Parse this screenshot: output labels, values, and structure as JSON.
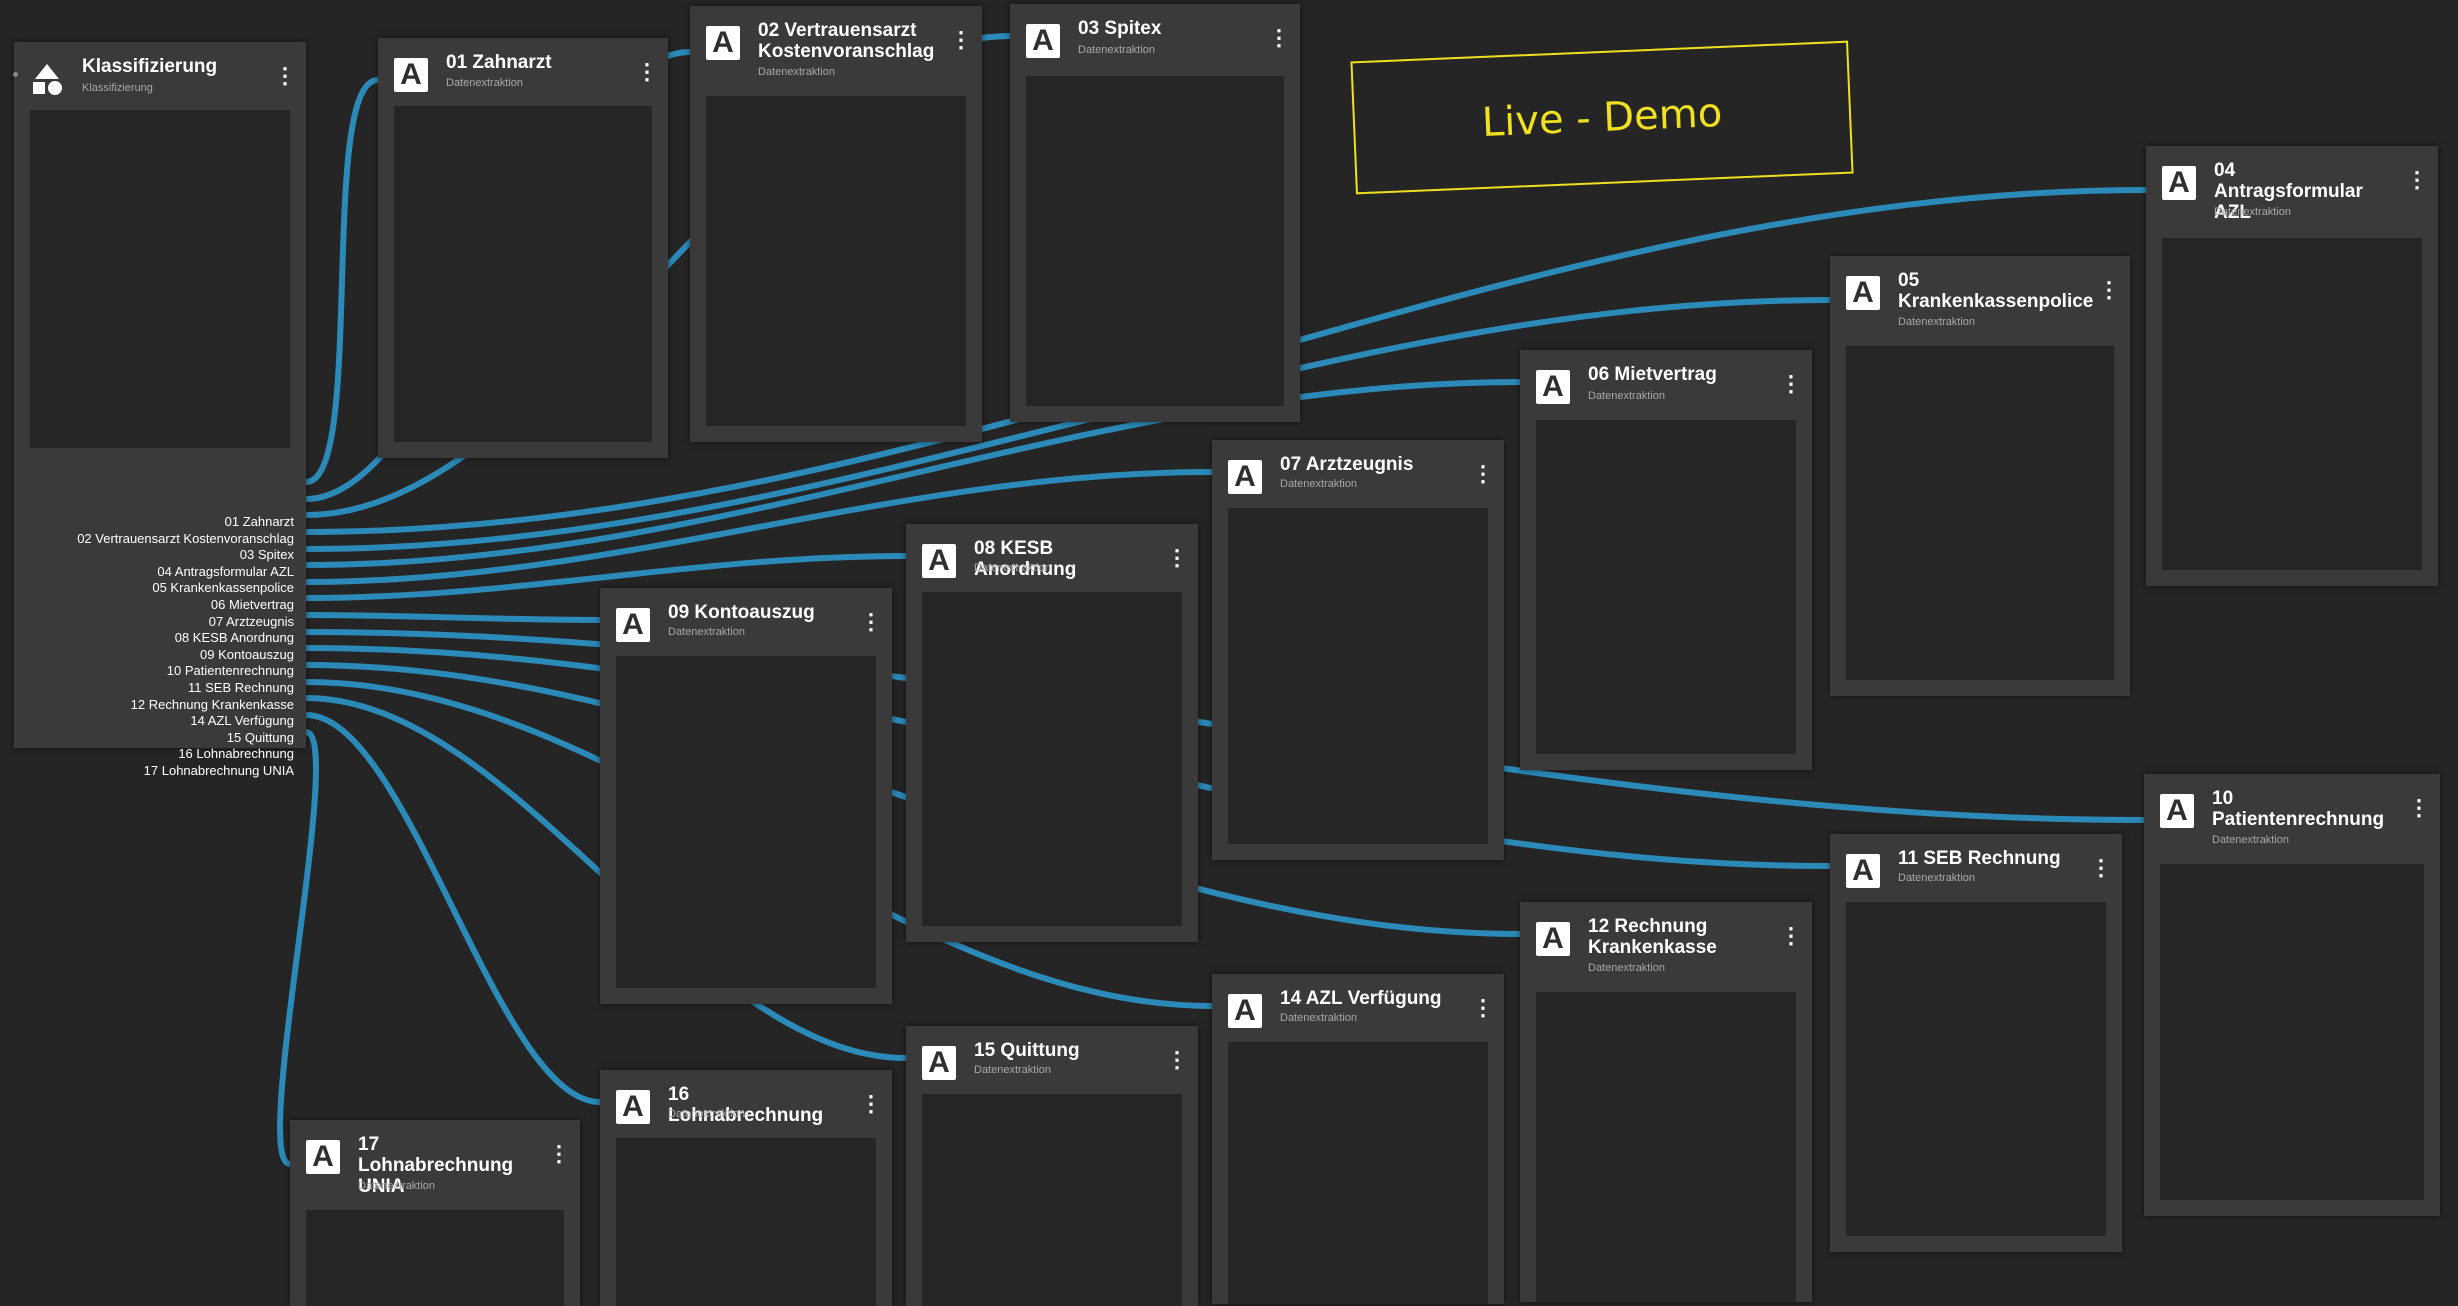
{
  "colors": {
    "canvas": "#252525",
    "node": "#3a3a3a",
    "node_body": "#262626",
    "wire": "#2b8ab8",
    "annotation": "#f0e020"
  },
  "classifier": {
    "title": "Klassifizierung",
    "subtitle": "Klassifizierung",
    "icon": "shapes-icon",
    "outputs": [
      "01 Zahnarzt",
      "02 Vertrauensarzt Kostenvoranschlag",
      "03 Spitex",
      "04 Antragsformular AZL",
      "05 Krankenkassenpolice",
      "06 Mietvertrag",
      "07 Arztzeugnis",
      "08 KESB Anordnung",
      "09 Kontoauszug",
      "10 Patientenrechnung",
      "11 SEB Rechnung",
      "12 Rechnung Krankenkasse",
      "14 AZL Verfügung",
      "15 Quittung",
      "16 Lohnabrechnung",
      "17 Lohnabrechnung UNIA"
    ]
  },
  "extraction_nodes": [
    {
      "title": "01 Zahnarzt",
      "subtitle": "Datenextraktion",
      "icon": "A"
    },
    {
      "title": "02 Vertrauensarzt\nKostenvoranschlag",
      "subtitle": "Datenextraktion",
      "icon": "A"
    },
    {
      "title": "03 Spitex",
      "subtitle": "Datenextraktion",
      "icon": "A"
    },
    {
      "title": "04 Antragsformular\nAZL",
      "subtitle": "Datenextraktion",
      "icon": "A"
    },
    {
      "title": "05\nKrankenkassenpolice",
      "subtitle": "Datenextraktion",
      "icon": "A"
    },
    {
      "title": "06 Mietvertrag",
      "subtitle": "Datenextraktion",
      "icon": "A"
    },
    {
      "title": "07 Arztzeugnis",
      "subtitle": "Datenextraktion",
      "icon": "A"
    },
    {
      "title": "08 KESB Anordnung",
      "subtitle": "Datenextraktion",
      "icon": "A"
    },
    {
      "title": "09 Kontoauszug",
      "subtitle": "Datenextraktion",
      "icon": "A"
    },
    {
      "title": "10\nPatientenrechnung",
      "subtitle": "Datenextraktion",
      "icon": "A"
    },
    {
      "title": "11 SEB Rechnung",
      "subtitle": "Datenextraktion",
      "icon": "A"
    },
    {
      "title": "12 Rechnung\nKrankenkasse",
      "subtitle": "Datenextraktion",
      "icon": "A"
    },
    {
      "title": "14 AZL Verfügung",
      "subtitle": "Datenextraktion",
      "icon": "A"
    },
    {
      "title": "15 Quittung",
      "subtitle": "Datenextraktion",
      "icon": "A"
    },
    {
      "title": "16 Lohnabrechnung",
      "subtitle": "Datenextraktion",
      "icon": "A"
    },
    {
      "title": "17 Lohnabrechnung\nUNIA",
      "subtitle": "Datenextraktion",
      "icon": "A"
    }
  ],
  "menu_icon": "⋮",
  "annotation": {
    "text": "Live - Demo"
  }
}
